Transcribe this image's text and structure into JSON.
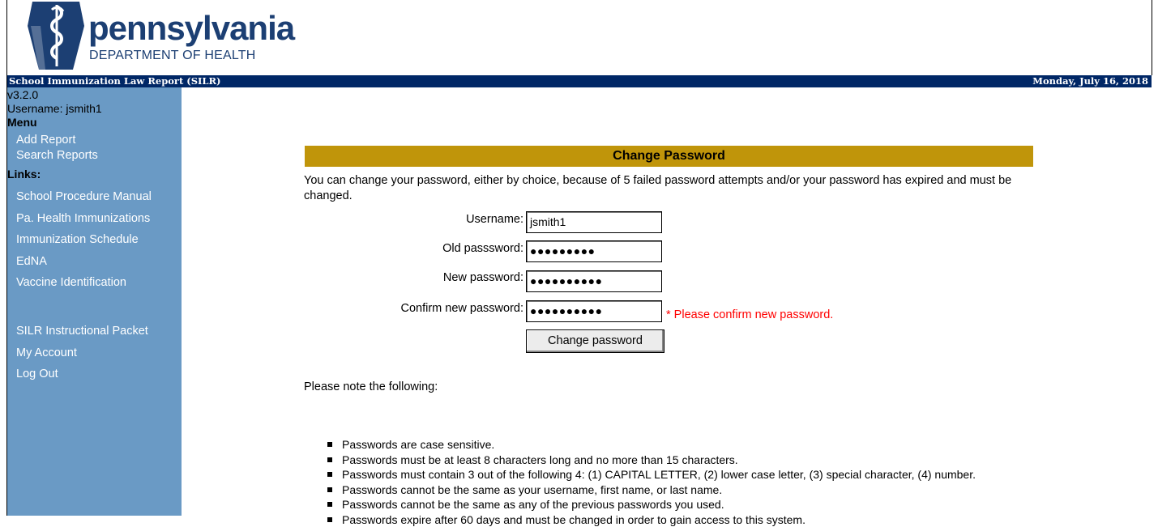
{
  "brand": {
    "name": "pennsylvania",
    "department": "DEPARTMENT OF HEALTH",
    "logo_icon": "keystone-caduceus-logo",
    "color": "#1c3f73"
  },
  "titlebar": {
    "app_title": "School Immunization Law Report (SILR)",
    "date": "Monday, July 16, 2018",
    "background": "#002766"
  },
  "sidebar": {
    "version": "v3.2.0",
    "username": "Username: jsmith1",
    "menu_heading": "Menu",
    "menu_items": [
      {
        "label": "Add Report"
      },
      {
        "label": "Search Reports"
      }
    ],
    "links_heading": "Links:",
    "links": [
      {
        "label": "School Procedure Manual"
      },
      {
        "label": "Pa. Health Immunizations"
      },
      {
        "label": "Immunization Schedule"
      },
      {
        "label": "EdNA"
      },
      {
        "label": "Vaccine Identification"
      }
    ],
    "account_links": [
      {
        "label": "SILR Instructional Packet"
      },
      {
        "label": "My Account"
      },
      {
        "label": "Log Out"
      }
    ],
    "background": "#6a9ac5"
  },
  "panel": {
    "title": "Change Password",
    "intro": "You can change your password, either by choice, because of 5 failed password attempts and/or your password has expired and must be changed.",
    "header_color": "#c0950a"
  },
  "form": {
    "username_label": "Username:",
    "username_value": "jsmith1",
    "old_password_label": "Old passsword:",
    "old_password_value": "●●●●●●●●●",
    "new_password_label": "New password:",
    "new_password_value": "●●●●●●●●●●",
    "confirm_password_label": "Confirm new password:",
    "confirm_password_value": "●●●●●●●●●●",
    "confirm_error": "* Please confirm new password.",
    "submit_label": "Change password"
  },
  "notes": {
    "heading": "Please note the following:",
    "items": [
      "Passwords are case sensitive.",
      "Passwords must be at least 8 characters long and no more than 15 characters.",
      "Passwords must contain 3 out of the following 4: (1) CAPITAL LETTER, (2) lower case letter, (3) special character, (4) number.",
      "Passwords cannot be the same as your username, first name, or last name.",
      "Passwords cannot be the same as any of the previous passwords you used.",
      "Passwords expire after 60 days and must be changed in order to gain access to this system."
    ]
  }
}
